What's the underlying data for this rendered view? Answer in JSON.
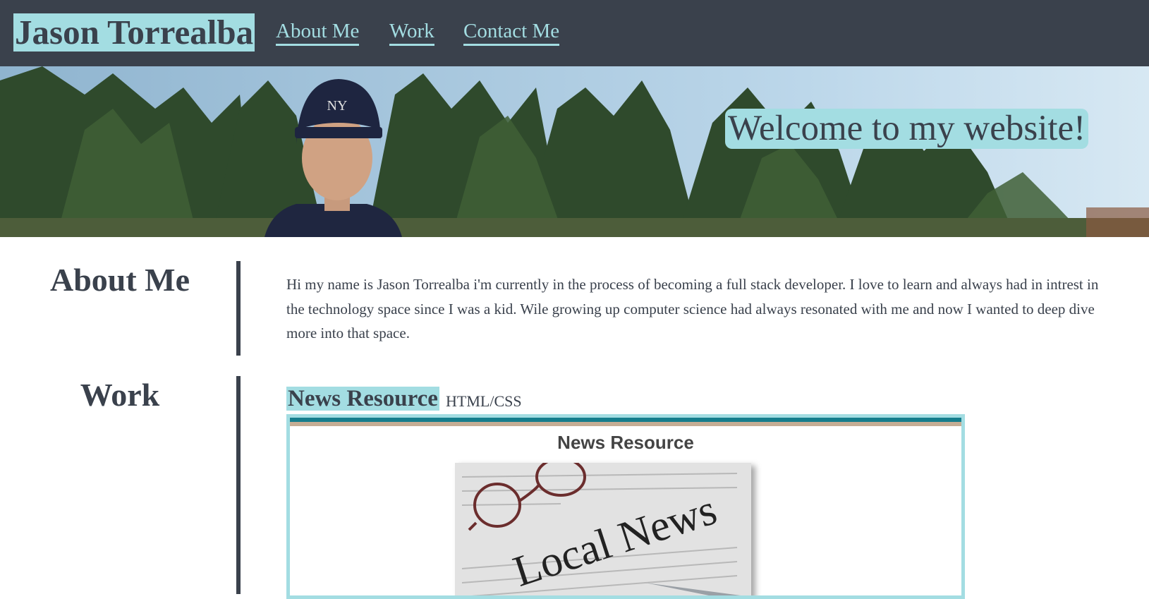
{
  "header": {
    "site_name": "Jason Torrealba",
    "nav": [
      {
        "label": "About Me"
      },
      {
        "label": "Work"
      },
      {
        "label": "Contact Me"
      }
    ]
  },
  "hero": {
    "welcome": "Welcome to my website!"
  },
  "about": {
    "title": "About Me",
    "text": "Hi my name is Jason Torrealba i'm currently in the process of becoming a full stack developer. I love to learn and always had in intrest in the technology space since I was a kid. Wile growing up computer science had always resonated with me and now I wanted to deep dive more into that space."
  },
  "work": {
    "title": "Work",
    "project": {
      "name": "News Resource",
      "tech": "HTML/CSS",
      "preview_heading": "News Resource",
      "image_text": "Local News"
    }
  },
  "colors": {
    "dark": "#3a414c",
    "accent": "#a3dde2",
    "teal_bar": "#157d8c",
    "tan_bar": "#c5ad94"
  }
}
